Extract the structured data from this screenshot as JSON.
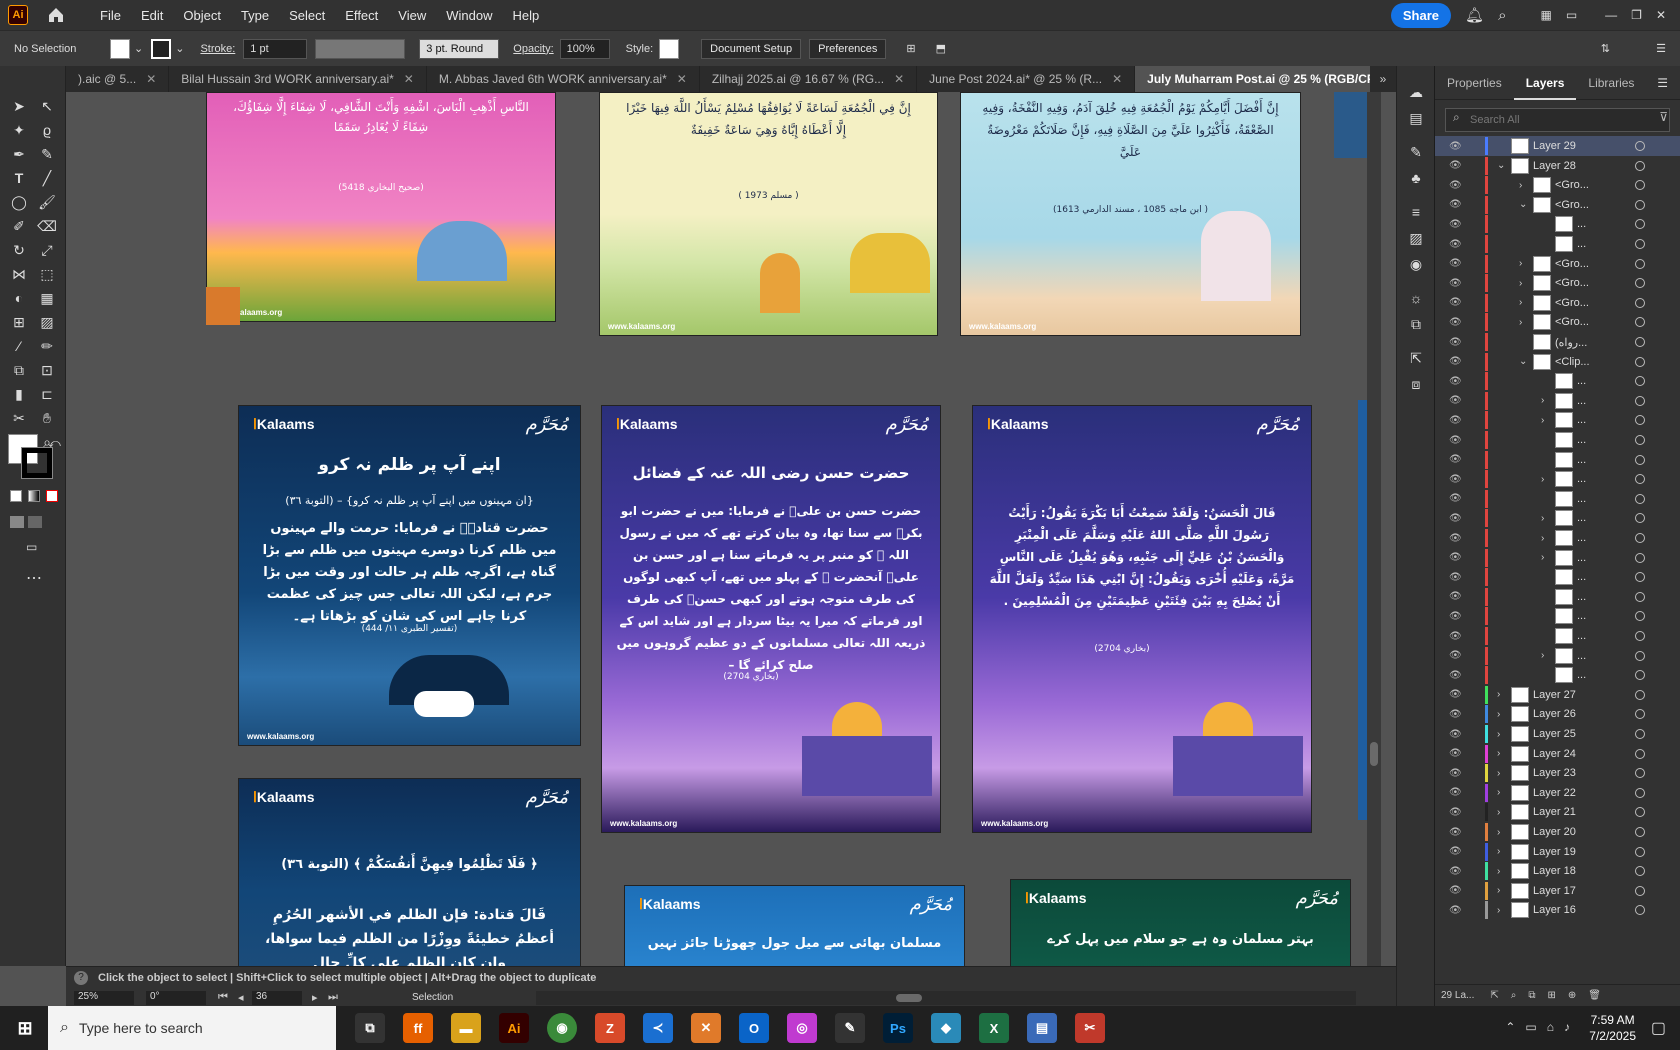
{
  "app": {
    "logo": "Ai"
  },
  "menu": [
    "File",
    "Edit",
    "Object",
    "Type",
    "Select",
    "Effect",
    "View",
    "Window",
    "Help"
  ],
  "share_label": "Share",
  "control": {
    "selection": "No Selection",
    "stroke_label": "Stroke:",
    "stroke_value": "1 pt",
    "brush": "3 pt. Round",
    "opacity_label": "Opacity:",
    "opacity_value": "100%",
    "style_label": "Style:",
    "doc_setup": "Document Setup",
    "preferences": "Preferences"
  },
  "tabs": [
    {
      "label": ").aic @ 5..."
    },
    {
      "label": "Bilal Hussain  3rd  WORK anniversary.ai*"
    },
    {
      "label": "M. Abbas Javed  6th  WORK anniversary.ai*"
    },
    {
      "label": "Zilhajj 2025.ai @ 16.67 % (RG..."
    },
    {
      "label": "June Post 2024.ai* @ 25 % (R..."
    },
    {
      "label": "July Muharram Post.ai @ 25 % (RGB/CPU Preview)"
    }
  ],
  "panel": {
    "tabs": [
      "Properties",
      "Layers",
      "Libraries"
    ],
    "search_placeholder": "Search All",
    "layers": [
      {
        "name": "Layer 29",
        "color": "#4a7cff",
        "indent": 0,
        "arrow": "",
        "sel": true
      },
      {
        "name": "Layer 28",
        "color": "#e0453f",
        "indent": 0,
        "arrow": "⌄"
      },
      {
        "name": "<Gro...",
        "color": "#e0453f",
        "indent": 1,
        "arrow": "›"
      },
      {
        "name": "<Gro...",
        "color": "#e0453f",
        "indent": 1,
        "arrow": "⌄"
      },
      {
        "name": "...",
        "color": "#e0453f",
        "indent": 2,
        "arrow": ""
      },
      {
        "name": "...",
        "color": "#e0453f",
        "indent": 2,
        "arrow": ""
      },
      {
        "name": "<Gro...",
        "color": "#e0453f",
        "indent": 1,
        "arrow": "›"
      },
      {
        "name": "<Gro...",
        "color": "#e0453f",
        "indent": 1,
        "arrow": "›"
      },
      {
        "name": "<Gro...",
        "color": "#e0453f",
        "indent": 1,
        "arrow": "›"
      },
      {
        "name": "<Gro...",
        "color": "#e0453f",
        "indent": 1,
        "arrow": "›"
      },
      {
        "name": "(رواه...",
        "color": "#e0453f",
        "indent": 1,
        "arrow": ""
      },
      {
        "name": "<Clip...",
        "color": "#e0453f",
        "indent": 1,
        "arrow": "⌄"
      },
      {
        "name": "...",
        "color": "#e0453f",
        "indent": 2,
        "arrow": ""
      },
      {
        "name": "...",
        "color": "#e0453f",
        "indent": 2,
        "arrow": "›"
      },
      {
        "name": "...",
        "color": "#e0453f",
        "indent": 2,
        "arrow": "›"
      },
      {
        "name": "...",
        "color": "#e0453f",
        "indent": 2,
        "arrow": ""
      },
      {
        "name": "...",
        "color": "#e0453f",
        "indent": 2,
        "arrow": ""
      },
      {
        "name": "...",
        "color": "#e0453f",
        "indent": 2,
        "arrow": "›"
      },
      {
        "name": "...",
        "color": "#e0453f",
        "indent": 2,
        "arrow": ""
      },
      {
        "name": "...",
        "color": "#e0453f",
        "indent": 2,
        "arrow": "›"
      },
      {
        "name": "...",
        "color": "#e0453f",
        "indent": 2,
        "arrow": "›"
      },
      {
        "name": "...",
        "color": "#e0453f",
        "indent": 2,
        "arrow": "›"
      },
      {
        "name": "...",
        "color": "#e0453f",
        "indent": 2,
        "arrow": ""
      },
      {
        "name": "...",
        "color": "#e0453f",
        "indent": 2,
        "arrow": ""
      },
      {
        "name": "...",
        "color": "#e0453f",
        "indent": 2,
        "arrow": ""
      },
      {
        "name": "...",
        "color": "#e0453f",
        "indent": 2,
        "arrow": ""
      },
      {
        "name": "...",
        "color": "#e0453f",
        "indent": 2,
        "arrow": "›"
      },
      {
        "name": "...",
        "color": "#e0453f",
        "indent": 2,
        "arrow": ""
      },
      {
        "name": "Layer 27",
        "color": "#3fe05c",
        "indent": 0,
        "arrow": "›"
      },
      {
        "name": "Layer 26",
        "color": "#3f8ae0",
        "indent": 0,
        "arrow": "›"
      },
      {
        "name": "Layer 25",
        "color": "#3fe0e0",
        "indent": 0,
        "arrow": "›"
      },
      {
        "name": "Layer 24",
        "color": "#e03fd5",
        "indent": 0,
        "arrow": "›"
      },
      {
        "name": "Layer 23",
        "color": "#e0d53f",
        "indent": 0,
        "arrow": "›"
      },
      {
        "name": "Layer 22",
        "color": "#a03fe0",
        "indent": 0,
        "arrow": "›"
      },
      {
        "name": "Layer 21",
        "color": "#222222",
        "indent": 0,
        "arrow": "›"
      },
      {
        "name": "Layer 20",
        "color": "#e07f3f",
        "indent": 0,
        "arrow": "›"
      },
      {
        "name": "Layer 19",
        "color": "#3f5ee0",
        "indent": 0,
        "arrow": "›"
      },
      {
        "name": "Layer 18",
        "color": "#3fe0a0",
        "indent": 0,
        "arrow": "›"
      },
      {
        "name": "Layer 17",
        "color": "#e0a03f",
        "indent": 0,
        "arrow": "›"
      },
      {
        "name": "Layer 16",
        "color": "#9a9a9a",
        "indent": 0,
        "arrow": "›"
      }
    ],
    "footer": "29 La..."
  },
  "status": {
    "hint": "Click the object to select  |  Shift+Click to select multiple object  |  Alt+Drag the object to duplicate",
    "zoom": "25%",
    "rotate": "0°",
    "artboard": "36",
    "tool": "Selection"
  },
  "taskbar": {
    "search": "Type here to search",
    "time": "7:59 AM",
    "date": "7/2/2025"
  },
  "cards": {
    "brand": "Kalaams",
    "muharram": "مُحَرَّم",
    "site": "www.kalaams.org",
    "c1_title": "اپنے آپ پر ظلم نہ کرو",
    "c1_ref": "{ان مہینوں میں اپنے آپ پر ظلم نہ کرو} – (التوبة ٣٦)",
    "c1_body": "حضرت قتادہؒ نے فرمایا: حرمت والے مہینوں میں ظلم کرنا دوسرے مہینوں میں ظلم سے بڑا گناہ ہے، اگرچہ ظلم ہر حالت اور وقت میں بڑا جرم ہے، لیکن اللہ تعالی جس چیز کی عظمت کرنا چاہے اس کی شان کو بڑھاتا ہے۔",
    "c1_src": "(تفسیر الطبری ١١/ 444)",
    "c2_title": "حضرت حسن رضی اللہ عنہ کے فضائل",
    "c2_body": "حضرت حسن بن علیؓ نے فرمایا: میں نے حضرت ابو بکرؓ سے سنا تھا، وہ بیان کرتے تھے کہ میں نے رسول اللہ ﷺ کو منبر پر یہ فرماتے سنا ہے اور حسن بن علیؓ آنحضرت ﷺ کے پہلو میں تھے، آپ کبھی لوگوں کی طرف متوجہ ہوتے اور کبھی حسنؓ کی طرف اور فرماتے کہ میرا یہ بیٹا سردار ہے اور شاید اس کے ذریعہ اللہ تعالی مسلمانوں کے دو عظیم گروہوں میں صلح کرائے گا –",
    "c2_src": "(بخاري 2704)",
    "c3_body": "قَالَ الْحَسَنُ: وَلَقَدْ سَمِعْتُ أَبَا بَكْرَةَ يَقُولُ: رَأَيْتُ رَسُولَ اللَّهِ صَلَّى اللهُ عَلَيْهِ وَسَلَّمَ عَلَى الْمِنْبَرِ وَالْحَسَنُ بْنُ عَلِيٍّ إِلَى جَنْبِهِ، وَهُوَ يُقْبِلُ عَلَى النَّاسِ مَرَّةً، وَعَلَيْهِ أُخْرَى وَيَقُولُ: إِنَّ ابْنِي هَذَا سَيِّدٌ وَلَعَلَّ اللَّهَ أَنْ يُصْلِحَ بِهِ بَيْنَ فِئَتَيْنِ عَظِيمَتَيْنِ مِنَ الْمُسْلِمِينَ .",
    "c3_src": "(بخاري 2704)",
    "c4_ref": "﴿ فَلَا تَظْلِمُوا فِيهِنَّ أَنفُسَكُمْ ﴾ (التوبة ٣٦)",
    "c4_body": "قَالَ قتادة: فإن الظلم في الأشهر الحُرُمِ أعظمُ خطيئةً ووِزْرًا من الظلم فيما سواها، وإن كان الظلم على كلِّ حالٍ",
    "c5_body": "مسلمان بھائی سے میل جول چھوڑنا جائز نہیں",
    "c6_body": "بہتر مسلمان وہ ہے جو سلام میں پہل کرے",
    "t1_text": "النَّاسِ أَذْهِبِ الْبَاسَ، اشْفِهِ وَأَنْتَ الشَّافِي، لَا شِفَاءَ إِلَّا شِفَاؤُكَ، شِفَاءً لَا يُغَادِرُ سَقَمًا",
    "t1_src": "(صحيح البخاري 5418)",
    "t2_text": "إِنَّ فِي الْجُمُعَةِ لَسَاعَةً لَا يُوَافِقُهَا مُسْلِمٌ يَسْأَلُ اللَّهَ فِيهَا خَيْرًا إِلَّا أَعْطَاهُ إِيَّاهُ وَهِيَ سَاعَةٌ خَفِيفَةٌ",
    "t2_src": "( مسلم 1973 )",
    "t3_text": "إِنَّ أَفْضَلَ أَيَّامِكُمْ يَوْمُ الْجُمُعَةِ فِيهِ خُلِقَ آدَمُ، وَفِيهِ النَّفْخَةُ، وَفِيهِ الصَّعْقَةُ، فَأَكْثِرُوا عَلَيَّ مِنَ الصَّلَاةِ فِيهِ، فَإِنَّ صَلَاتَكُمْ مَعْرُوضَةٌ عَلَيَّ",
    "t3_src": "( ابن ماجه 1085 ، مسند الدارمي 1613)"
  }
}
